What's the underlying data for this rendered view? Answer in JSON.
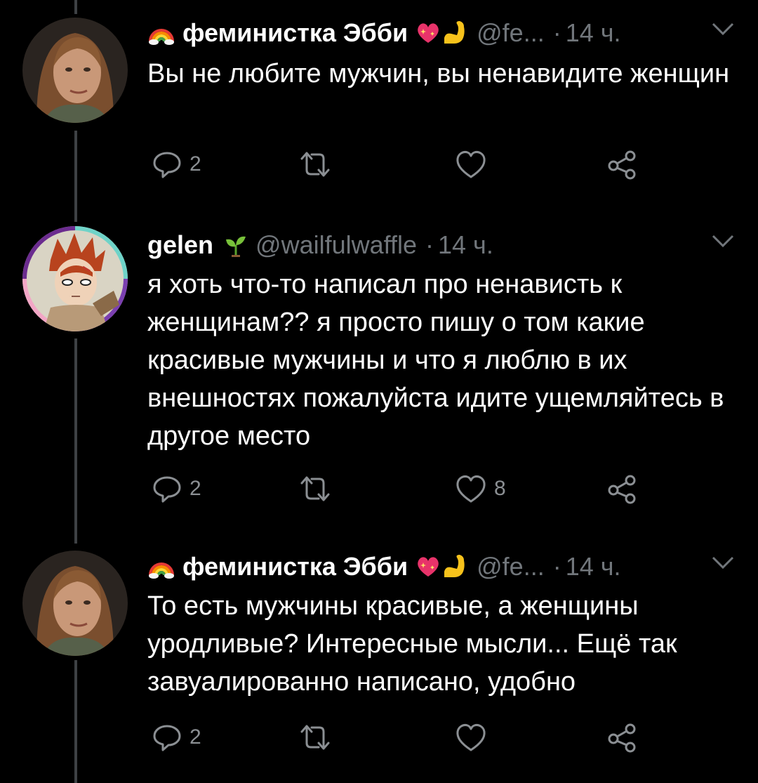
{
  "tweets": [
    {
      "name": "феминистка Эбби",
      "handle": "@fe...",
      "dot": "·",
      "time": "14 ч.",
      "text": "Вы не любите мужчин, вы ненавидите женщин",
      "replies": "2",
      "retweets": "",
      "likes": ""
    },
    {
      "name": "gelen",
      "handle": "@wailfulwaffle",
      "dot": "·",
      "time": "14 ч.",
      "text": "я хоть что-то написал про ненависть к женщинам?? я просто пишу о том какие красивые мужчины и что я люблю в их внешностях пожалуйста идите ущемляйтесь в другое место",
      "replies": "2",
      "retweets": "",
      "likes": "8"
    },
    {
      "name": "феминистка Эбби",
      "handle": "@fe...",
      "dot": "·",
      "time": "14 ч.",
      "text": "То есть мужчины красивые, а женщины уродливые? Интересные мысли... Ещё так завуалированно написано, удобно",
      "replies": "2",
      "retweets": "",
      "likes": ""
    }
  ],
  "colors": {
    "background": "#000000",
    "text": "#ffffff",
    "muted": "#71767b",
    "icon": "#8b8f93",
    "thread_line": "#3e4144"
  },
  "icons": [
    "rainbow-emoji-icon",
    "sparkling-heart-icon",
    "flexed-biceps-icon",
    "seedling-icon",
    "reply-icon",
    "retweet-icon",
    "like-icon",
    "share-icon",
    "chevron-down-icon"
  ]
}
